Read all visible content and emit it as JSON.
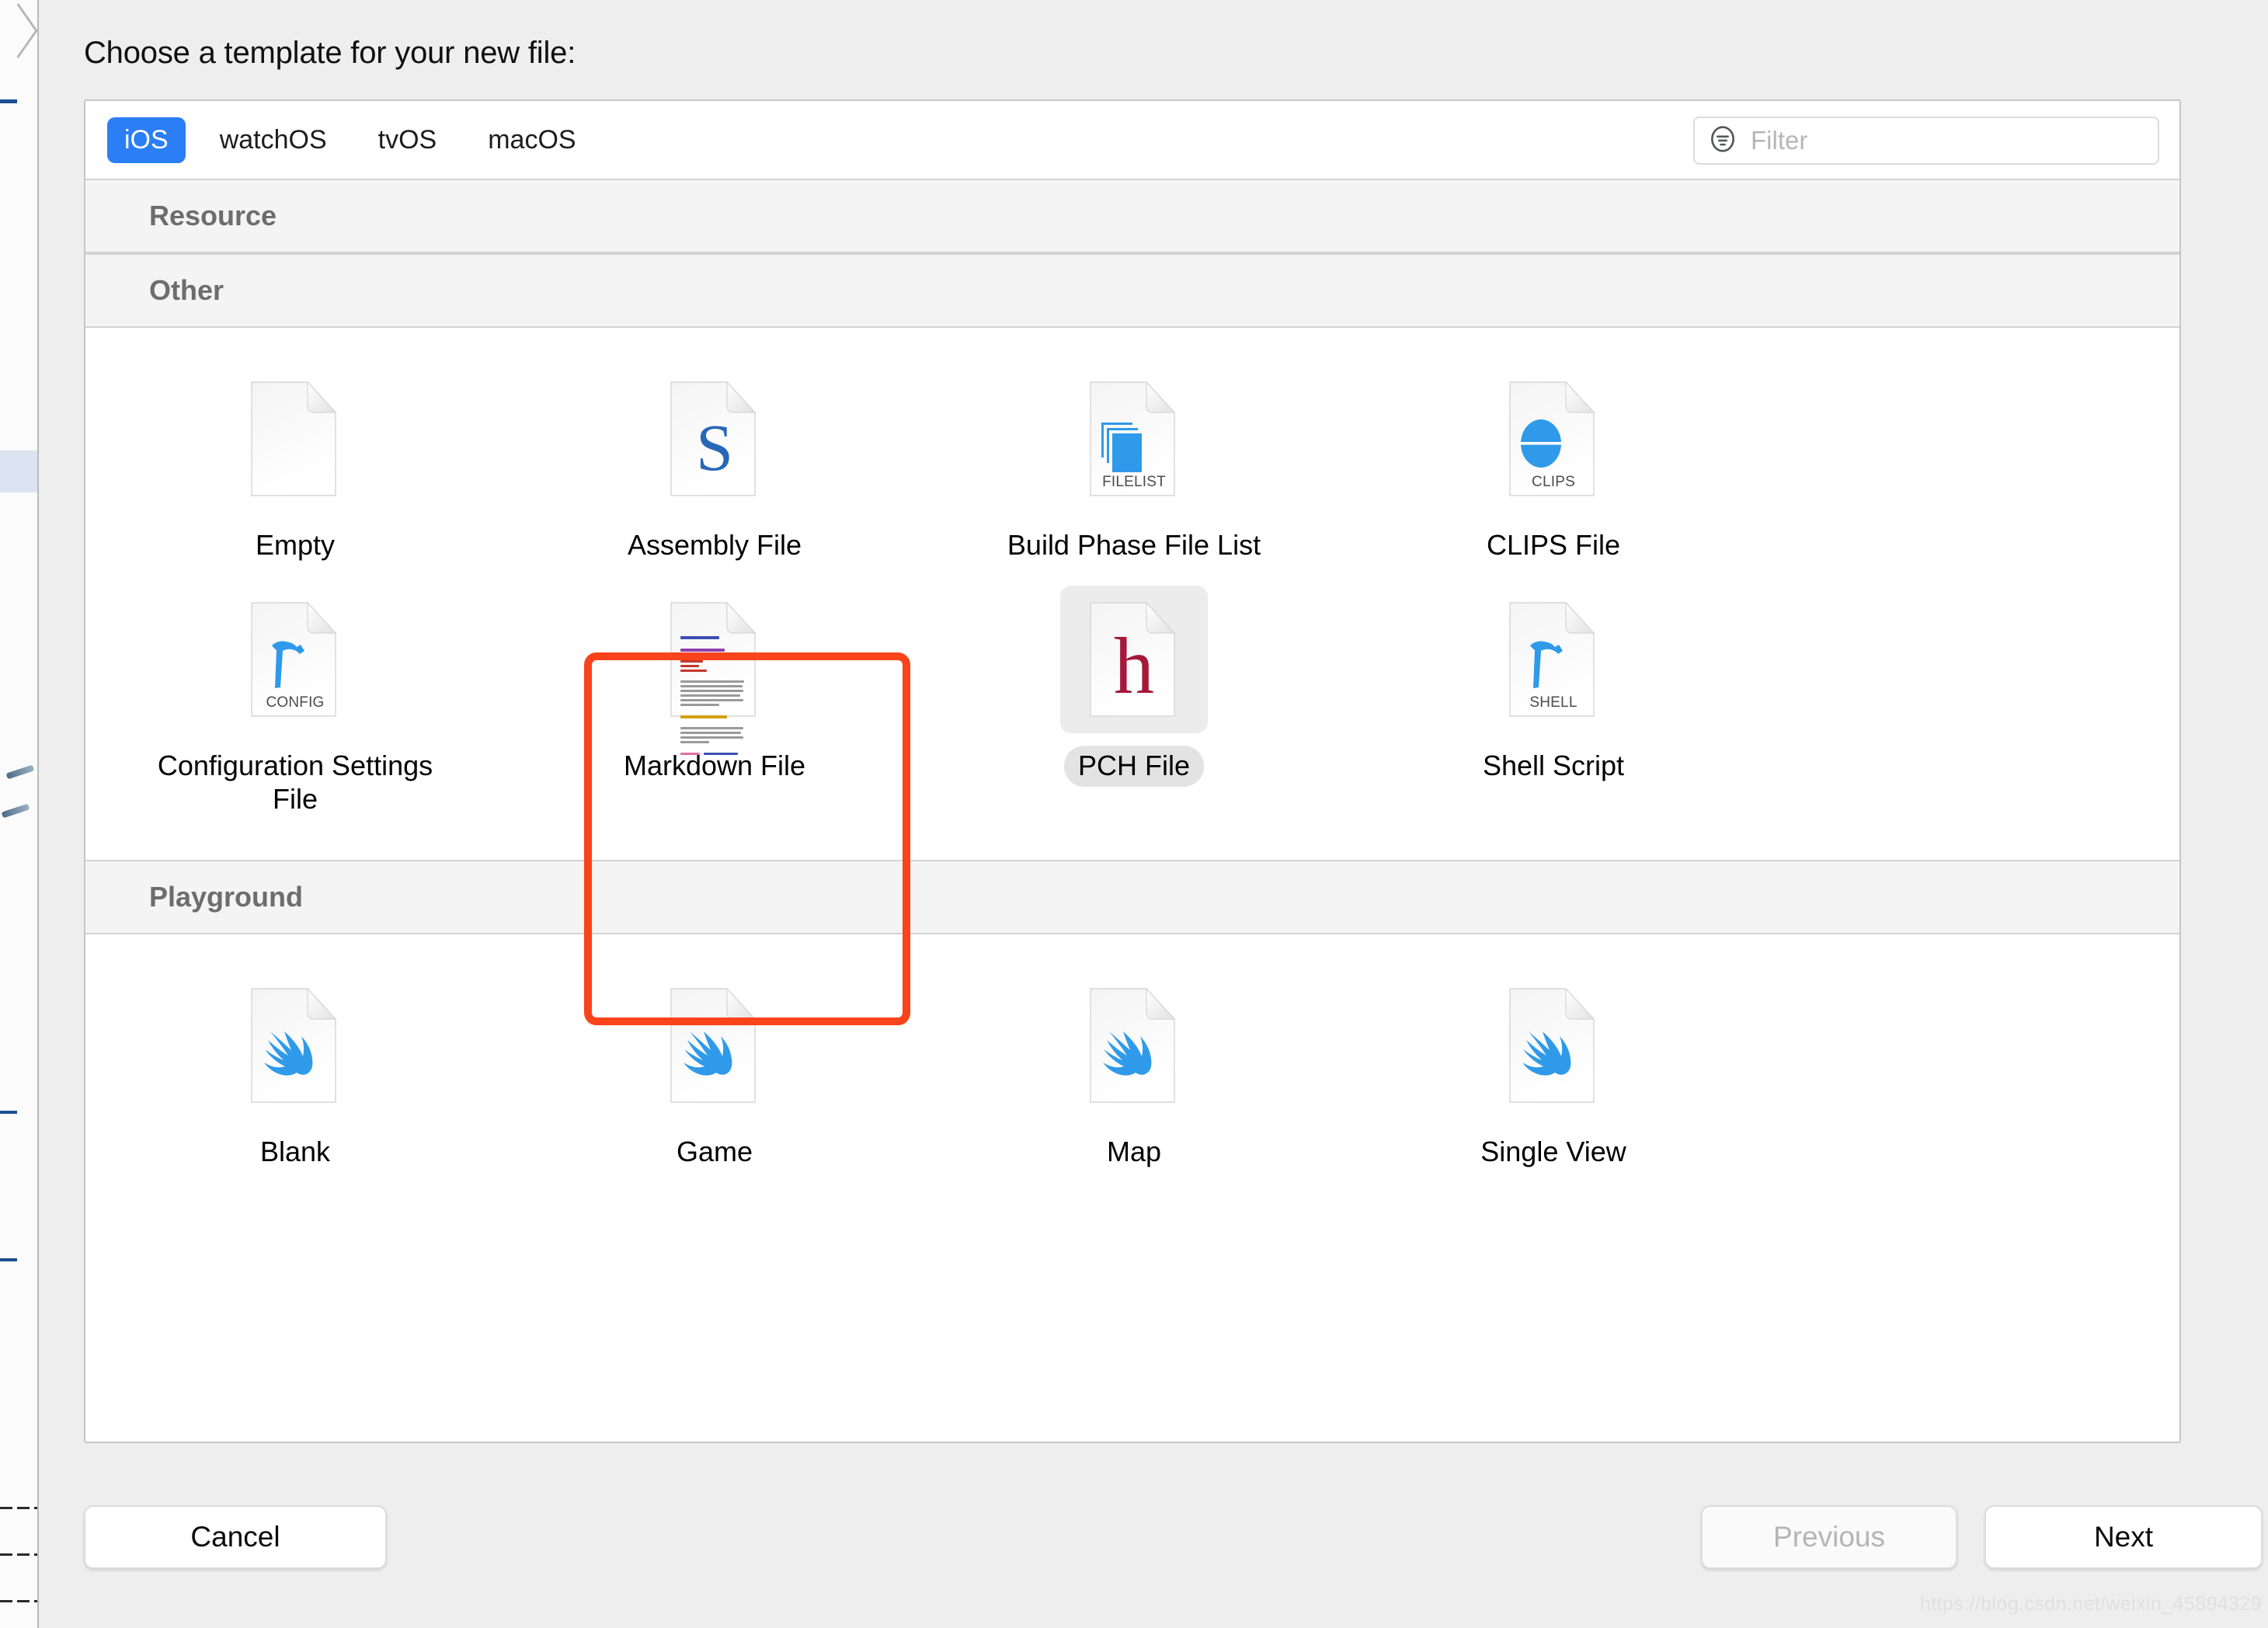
{
  "dialog": {
    "title": "Choose a template for your new file:"
  },
  "platform_tabs": [
    {
      "label": "iOS",
      "active": true
    },
    {
      "label": "watchOS",
      "active": false
    },
    {
      "label": "tvOS",
      "active": false
    },
    {
      "label": "macOS",
      "active": false
    }
  ],
  "filter": {
    "placeholder": "Filter",
    "value": "",
    "icon": "filter-icon"
  },
  "sections": [
    {
      "header": "Resource",
      "items": []
    },
    {
      "header": "Other",
      "items": [
        {
          "label": "Empty",
          "icon": "blank-document-icon",
          "badge": "",
          "selected": false
        },
        {
          "label": "Assembly File",
          "icon": "assembly-s-document-icon",
          "badge": "",
          "selected": false
        },
        {
          "label": "Build Phase File List",
          "icon": "filelist-document-icon",
          "badge": "FILELIST",
          "selected": false
        },
        {
          "label": "CLIPS File",
          "icon": "clips-document-icon",
          "badge": "CLIPS",
          "selected": false
        },
        {
          "label": "Configuration Settings File",
          "icon": "config-hammer-document-icon",
          "badge": "CONFIG",
          "selected": false
        },
        {
          "label": "Markdown File",
          "icon": "markdown-document-icon",
          "badge": "",
          "selected": false
        },
        {
          "label": "PCH File",
          "icon": "pch-h-document-icon",
          "badge": "",
          "selected": true
        },
        {
          "label": "Shell Script",
          "icon": "shell-hammer-document-icon",
          "badge": "SHELL",
          "selected": false
        }
      ]
    },
    {
      "header": "Playground",
      "items": [
        {
          "label": "Blank",
          "icon": "swift-playground-icon",
          "badge": "",
          "selected": false
        },
        {
          "label": "Game",
          "icon": "swift-playground-icon",
          "badge": "",
          "selected": false
        },
        {
          "label": "Map",
          "icon": "swift-playground-icon",
          "badge": "",
          "selected": false
        },
        {
          "label": "Single View",
          "icon": "swift-playground-icon",
          "badge": "",
          "selected": false
        }
      ]
    }
  ],
  "buttons": {
    "cancel": "Cancel",
    "previous": "Previous",
    "next": "Next",
    "previous_disabled": true
  },
  "watermark": "https://blog.csdn.net/weixin_45894329",
  "colors": {
    "accent_blue": "#2b7ef5",
    "annotation_red": "#f9431a",
    "icon_blue": "#2f9aea",
    "pch_red": "#a5183a",
    "assembly_blue": "#2667b8",
    "sheet_bg": "#eeeeee",
    "section_header_bg": "#f4f4f4"
  }
}
